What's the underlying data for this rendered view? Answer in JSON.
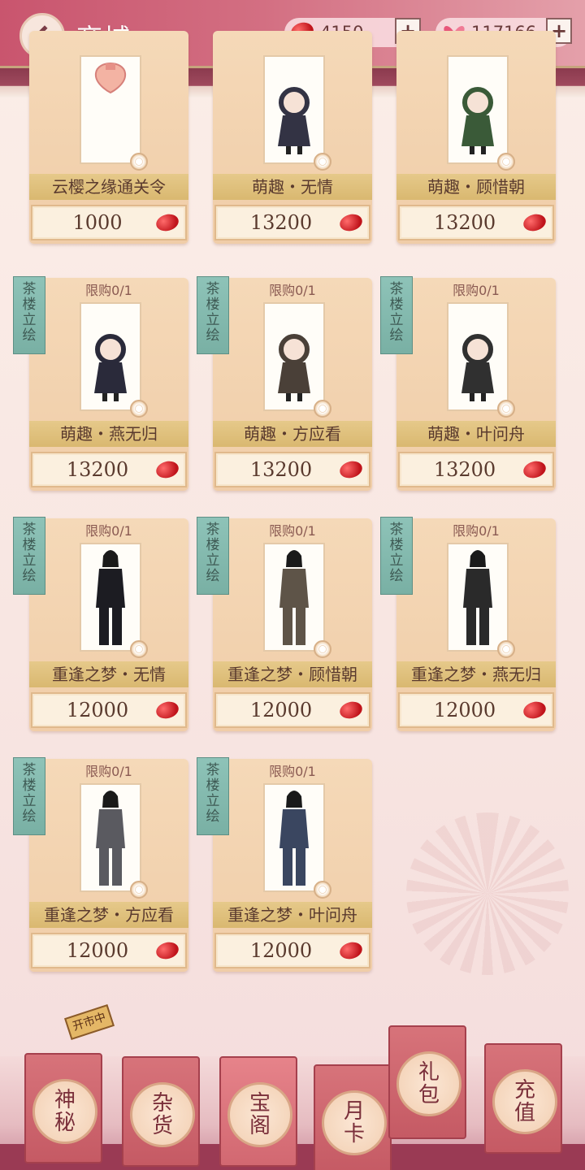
{
  "header": {
    "title": "商城",
    "currency_beans": "4150",
    "currency_butterflies": "117166",
    "plus_label": "+"
  },
  "items": [
    {
      "limit": "",
      "tag": false,
      "name": "云樱之缘通关令",
      "price": "1000"
    },
    {
      "limit": "",
      "tag": false,
      "name": "萌趣・无情",
      "price": "13200"
    },
    {
      "limit": "",
      "tag": false,
      "name": "萌趣・顾惜朝",
      "price": "13200"
    },
    {
      "limit": "限购0/1",
      "tag": true,
      "name": "萌趣・燕无归",
      "price": "13200"
    },
    {
      "limit": "限购0/1",
      "tag": true,
      "name": "萌趣・方应看",
      "price": "13200"
    },
    {
      "limit": "限购0/1",
      "tag": true,
      "name": "萌趣・叶问舟",
      "price": "13200"
    },
    {
      "limit": "限购0/1",
      "tag": true,
      "name": "重逢之梦・无情",
      "price": "12000"
    },
    {
      "limit": "限购0/1",
      "tag": true,
      "name": "重逢之梦・顾惜朝",
      "price": "12000"
    },
    {
      "limit": "限购0/1",
      "tag": true,
      "name": "重逢之梦・燕无归",
      "price": "12000"
    },
    {
      "limit": "限购0/1",
      "tag": true,
      "name": "重逢之梦・方应看",
      "price": "12000"
    },
    {
      "limit": "限购0/1",
      "tag": true,
      "name": "重逢之梦・叶问舟",
      "price": "12000"
    }
  ],
  "tag_label": [
    "茶",
    "楼",
    "立",
    "绘"
  ],
  "nav": {
    "open_badge": "开市中",
    "tabs": [
      {
        "label": "神秘"
      },
      {
        "label": "杂货"
      },
      {
        "label": "宝阁"
      },
      {
        "label": "月卡"
      },
      {
        "label": "礼包"
      },
      {
        "label": "充值"
      }
    ]
  }
}
